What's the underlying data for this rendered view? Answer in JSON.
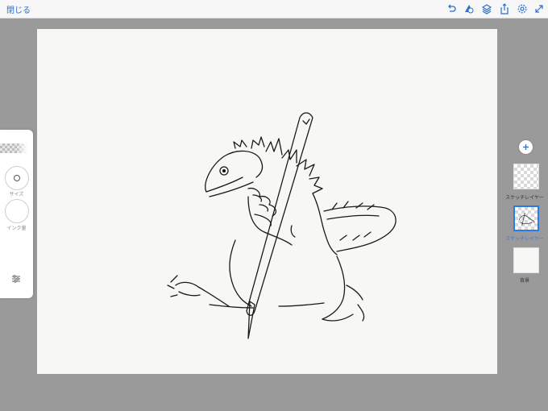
{
  "topbar": {
    "close_label": "閉じる",
    "icons": [
      "undo-icon",
      "tool-shape-icon",
      "layers-icon",
      "share-icon",
      "settings-icon",
      "fullscreen-icon"
    ]
  },
  "left_panel": {
    "size_label": "サイズ",
    "ink_label": "インク量",
    "icons": [
      "brush-preview",
      "size-control-icon",
      "ink-amount-icon",
      "brush-settings-icon"
    ]
  },
  "layers": {
    "add_icon": "plus-icon",
    "items": [
      {
        "label": "スケッチレイヤー",
        "selected": false
      },
      {
        "label": "スケッチレイヤー",
        "selected": true
      },
      {
        "label": "背景",
        "selected": false
      }
    ]
  },
  "colors": {
    "accent": "#2a7be4",
    "canvas": "#f7f7f5",
    "workspace": "#9a9a9a",
    "ink": "#1a1a1a"
  }
}
